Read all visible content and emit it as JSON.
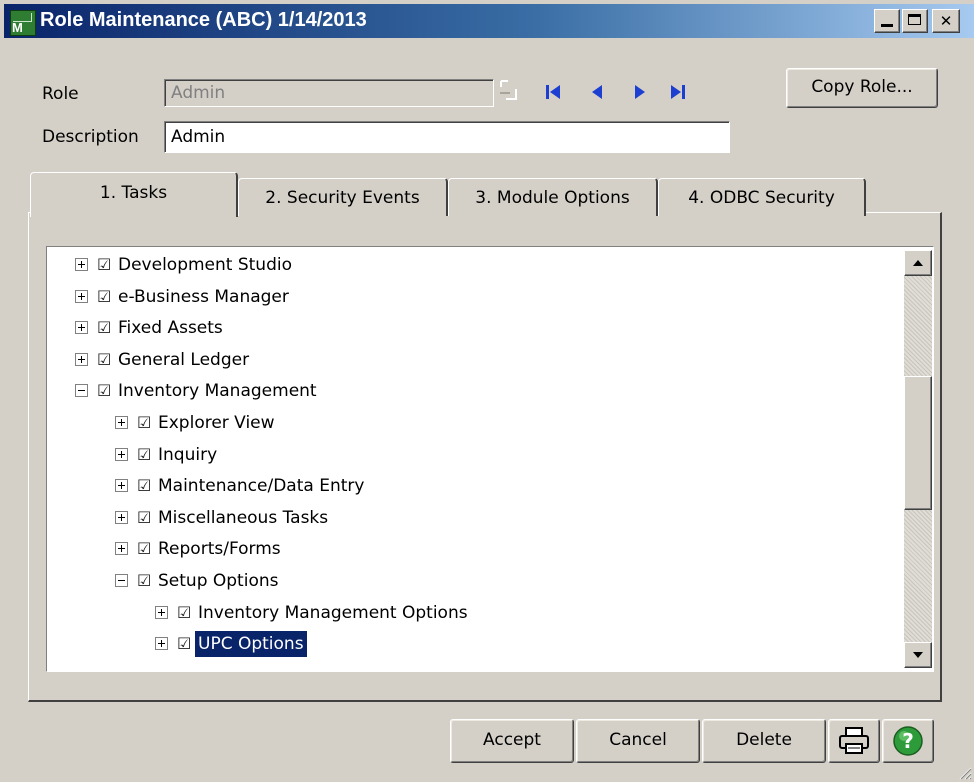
{
  "window": {
    "title": "Role Maintenance (ABC) 1/14/2013",
    "app_icon_text": "M"
  },
  "form": {
    "role_label": "Role",
    "role_value": "Admin",
    "description_label": "Description",
    "description_value": "Admin",
    "copy_role_label": "Copy Role..."
  },
  "tabs": [
    {
      "label": "1. Tasks",
      "active": true
    },
    {
      "label": "2. Security Events",
      "active": false
    },
    {
      "label": "3. Module Options",
      "active": false
    },
    {
      "label": "4. ODBC Security",
      "active": false
    }
  ],
  "tree": [
    {
      "label": "Development Studio",
      "level": 0,
      "expanded": false,
      "checked": true
    },
    {
      "label": "e-Business Manager",
      "level": 0,
      "expanded": false,
      "checked": true
    },
    {
      "label": "Fixed Assets",
      "level": 0,
      "expanded": false,
      "checked": true
    },
    {
      "label": "General Ledger",
      "level": 0,
      "expanded": false,
      "checked": true
    },
    {
      "label": "Inventory Management",
      "level": 0,
      "expanded": true,
      "checked": true
    },
    {
      "label": "Explorer View",
      "level": 1,
      "expanded": false,
      "checked": true
    },
    {
      "label": "Inquiry",
      "level": 1,
      "expanded": false,
      "checked": true
    },
    {
      "label": "Maintenance/Data Entry",
      "level": 1,
      "expanded": false,
      "checked": true
    },
    {
      "label": "Miscellaneous Tasks",
      "level": 1,
      "expanded": false,
      "checked": true
    },
    {
      "label": "Reports/Forms",
      "level": 1,
      "expanded": false,
      "checked": true
    },
    {
      "label": "Setup Options",
      "level": 1,
      "expanded": true,
      "checked": true
    },
    {
      "label": "Inventory Management Options",
      "level": 2,
      "expanded": false,
      "checked": true
    },
    {
      "label": "UPC Options",
      "level": 2,
      "expanded": false,
      "checked": true,
      "selected": true
    }
  ],
  "buttons": {
    "accept": "Accept",
    "cancel": "Cancel",
    "delete": "Delete"
  },
  "colors": {
    "selection": "#0a246a",
    "titlebar_start": "#0a246a",
    "titlebar_end": "#a6caf0",
    "nav_arrow": "#1c3fd1",
    "help": "#2e9b3a"
  },
  "icons": {
    "lookup": "lookup-icon",
    "first": "first-record-icon",
    "prev": "previous-record-icon",
    "next": "next-record-icon",
    "last": "last-record-icon",
    "print": "printer-icon",
    "help": "help-icon"
  }
}
